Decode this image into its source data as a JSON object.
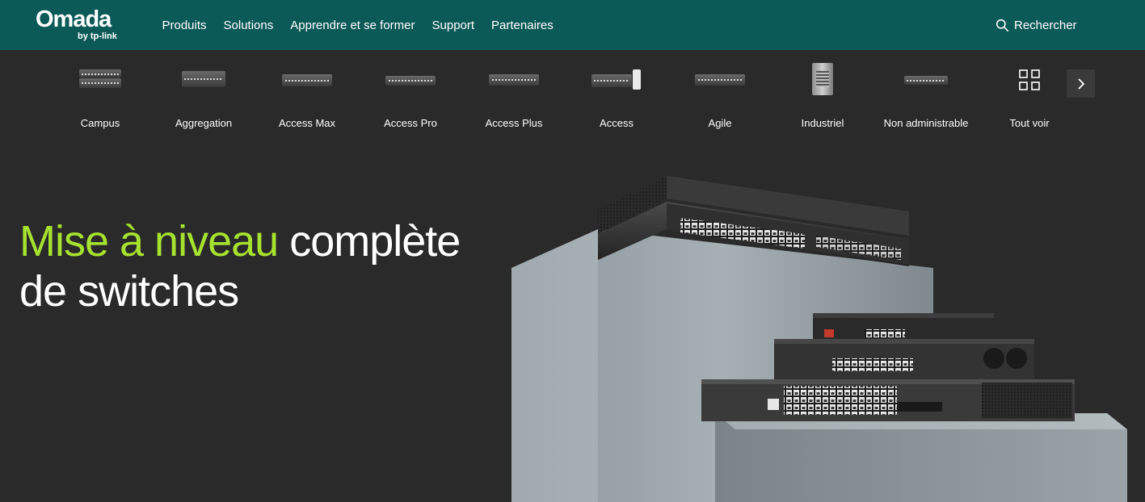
{
  "header": {
    "brand": "Omada",
    "brand_sub": "by tp-link",
    "nav": [
      "Produits",
      "Solutions",
      "Apprendre et se former",
      "Support",
      "Partenaires"
    ],
    "search_label": "Rechercher"
  },
  "categories": [
    {
      "label": "Campus",
      "icon": "switch-icon"
    },
    {
      "label": "Aggregation",
      "icon": "switch-icon"
    },
    {
      "label": "Access Max",
      "icon": "switch-icon"
    },
    {
      "label": "Access Pro",
      "icon": "switch-icon"
    },
    {
      "label": "Access Plus",
      "icon": "switch-icon"
    },
    {
      "label": "Access",
      "icon": "switch-icon"
    },
    {
      "label": "Agile",
      "icon": "switch-icon"
    },
    {
      "label": "Industriel",
      "icon": "industrial-switch-icon"
    },
    {
      "label": "Non administrable",
      "icon": "switch-icon"
    },
    {
      "label": "Tout voir",
      "icon": "grid-icon"
    }
  ],
  "hero": {
    "title_highlight": "Mise à niveau",
    "title_rest_line1": " complète",
    "title_line2": "de switches"
  },
  "colors": {
    "header_bg": "#0b5a58",
    "page_bg": "#2a2a2a",
    "accent": "#a6e22e"
  }
}
